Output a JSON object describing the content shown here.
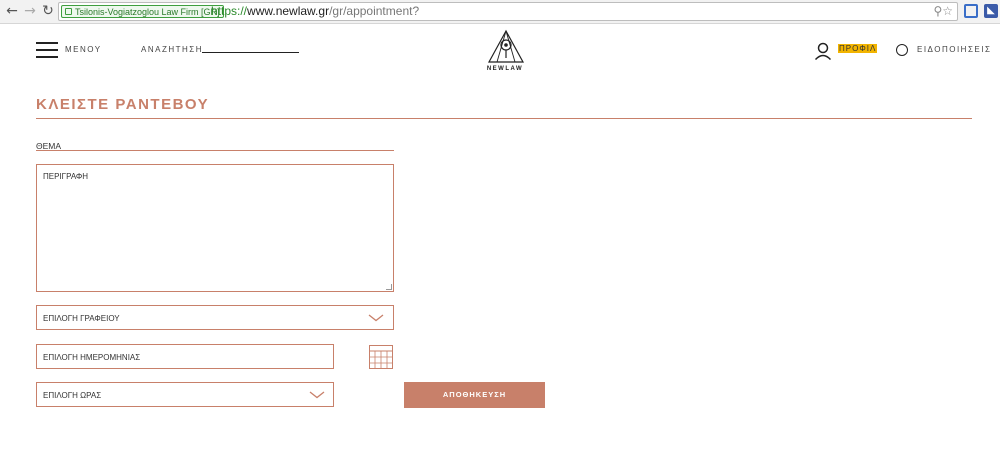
{
  "browser": {
    "ev_label": "Tsilonis-Vogiatzoglou Law Firm [GR]",
    "url_scheme": "https://",
    "url_host": "www.newlaw.gr",
    "url_path": "/gr/appointment?"
  },
  "header": {
    "menu_label": "ΜΕΝΟΥ",
    "search_label": "ΑΝΑΖΗΤΗΣΗ",
    "search_value": "",
    "logo_text": "NEWLAW",
    "profile_label": "ΠΡΟΦΙΛ",
    "notifications_label": "ΕΙΔΟΠΟΙΗΣΕΙΣ"
  },
  "page": {
    "title": "ΚΛΕΙΣΤΕ ΡΑΝΤΕΒΟΥ"
  },
  "form": {
    "subject_placeholder": "ΘΕΜΑ",
    "description_placeholder": "ΠΕΡΙΓΡΑΦΗ",
    "office_placeholder": "ΕΠΙΛΟΓΗ ΓΡΑΦΕΙΟΥ",
    "date_placeholder": "ΕΠΙΛΟΓΗ ΗΜΕΡΟΜΗΝΙΑΣ",
    "time_placeholder": "ΕΠΙΛΟΓΗ ΩΡΑΣ",
    "save_label": "ΑΠΟΘΗΚΕΥΣΗ"
  },
  "colors": {
    "accent": "#c8806a",
    "profile_highlight": "#f2b400"
  }
}
